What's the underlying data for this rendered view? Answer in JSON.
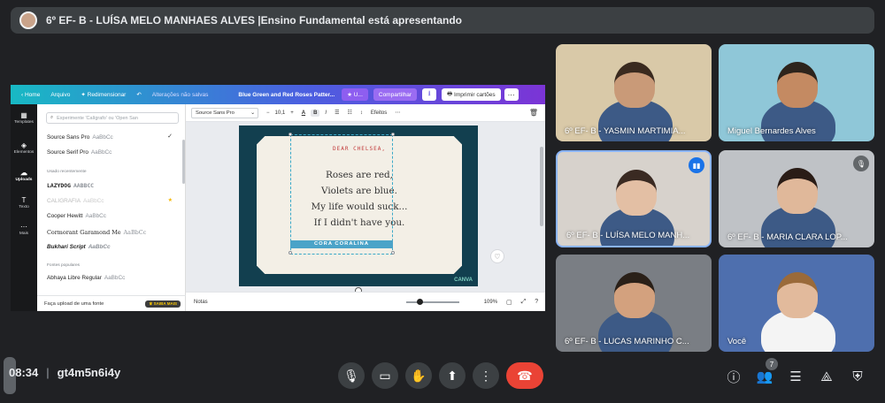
{
  "banner": {
    "text": "6º EF- B - LUÍSA MELO MANHAES ALVES |Ensino Fundamental está apresentando"
  },
  "canva": {
    "topbar": {
      "home": "Home",
      "arquivo": "Arquivo",
      "redimensionar": "✦ Redimensionar",
      "undo_status": "Alterações não salvas",
      "doc_title": "Blue Green and Red Roses Patter...",
      "user_pill": "★ U...",
      "share": "Compartilhar",
      "print": "Imprimir cartões"
    },
    "rail": [
      {
        "icon": "templates-icon",
        "glyph": "▦",
        "label": "Templates"
      },
      {
        "icon": "elements-icon",
        "glyph": "◈",
        "label": "Elementos"
      },
      {
        "icon": "uploads-icon",
        "glyph": "☁",
        "label": "Uploads"
      },
      {
        "icon": "text-icon",
        "glyph": "T",
        "label": "Texto"
      },
      {
        "icon": "more-icon",
        "glyph": "⋯",
        "label": "Mais"
      }
    ],
    "font_panel": {
      "search_placeholder": "Experimente 'Calígrafo' ou 'Open San",
      "fonts_top": [
        {
          "name": "Source Sans Pro",
          "sample": "AaBbCc"
        },
        {
          "name": "Source Serif Pro",
          "sample": "AaBbCc"
        }
      ],
      "recent_label": "Usado recentemente",
      "fonts_recent": [
        {
          "name": "LAZYDOG",
          "sample": "AABBCC"
        },
        {
          "name": "CALIGRAFIA",
          "sample": "AaBbCc"
        },
        {
          "name": "Cooper Hewitt",
          "sample": "AaBbCc"
        },
        {
          "name": "Cormorant Garamond Me",
          "sample": "AaBbCc"
        },
        {
          "name": "Bukhari Script",
          "sample": "AaBbCc"
        }
      ],
      "popular_label": "Fontes populares",
      "fonts_popular": [
        {
          "name": "Abhaya Libre Regular",
          "sample": "AaBbCc"
        }
      ],
      "upload_label": "Faça upload de uma fonte",
      "upload_badge": "♛ SAIBA MAIS"
    },
    "toolbar": {
      "font": "Source Sans Pro",
      "minus": "−",
      "size": "10,1",
      "plus": "+",
      "color": "A",
      "bold": "B",
      "italic": "I",
      "align": "☰",
      "list": "☷",
      "spacing": "↕",
      "effects": "Efeitos",
      "more": "⋯"
    },
    "card": {
      "dear": "DEAR CHELSEA,",
      "lines": [
        "Roses are red,",
        "Violets are blue.",
        "My life would suck...",
        "If I didn't have you."
      ],
      "signature": "CORA CORALINA",
      "logo": "CANVA"
    },
    "footer": {
      "notes": "Notas",
      "zoom": "109%"
    }
  },
  "participants": [
    {
      "name": "6º EF- B - YASMIN MARTIMIA...",
      "bg": "#d9c9a8",
      "skin": "#c99a78",
      "hair": "#3a2a1f"
    },
    {
      "name": "Miguel Bernardes Alves",
      "bg": "#8fc7d8",
      "skin": "#c48a62",
      "hair": "#2d241c"
    },
    {
      "name": "6º EF- B - LUÍSA MELO MANH...",
      "bg": "#d7d2cc",
      "skin": "#e3bfa4",
      "hair": "#3a2a22"
    },
    {
      "name": "6º EF- B - MARIA CLARA LOP...",
      "bg": "#bfc2c6",
      "skin": "#e0b89a",
      "hair": "#2a1c16"
    },
    {
      "name": "6º EF- B - LUCAS MARINHO C...",
      "bg": "#7a7e84",
      "skin": "#d3a17e",
      "hair": "#2a2018"
    },
    {
      "name": "Você",
      "bg": "#4e6fae",
      "skin": "#e2ba9c",
      "hair": "#9a6a3a"
    }
  ],
  "bottom": {
    "time": "08:34",
    "code": "gt4m5n6i4y",
    "people_count": "7"
  },
  "colors": {
    "accent": "#8ab4f8",
    "end_call": "#ea4335",
    "canva_purple": "#7b34d6"
  }
}
